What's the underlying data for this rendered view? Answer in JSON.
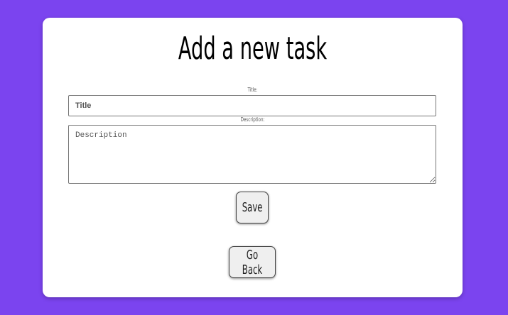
{
  "page": {
    "title": "Add a new task",
    "background_color": "#7b44ef"
  },
  "form": {
    "title_label": "Title:",
    "title_placeholder": "Title",
    "title_value": "",
    "description_label": "Description:",
    "description_placeholder": "Description",
    "description_value": "",
    "save_label": "Save"
  },
  "nav": {
    "back_label": "Go Back"
  }
}
